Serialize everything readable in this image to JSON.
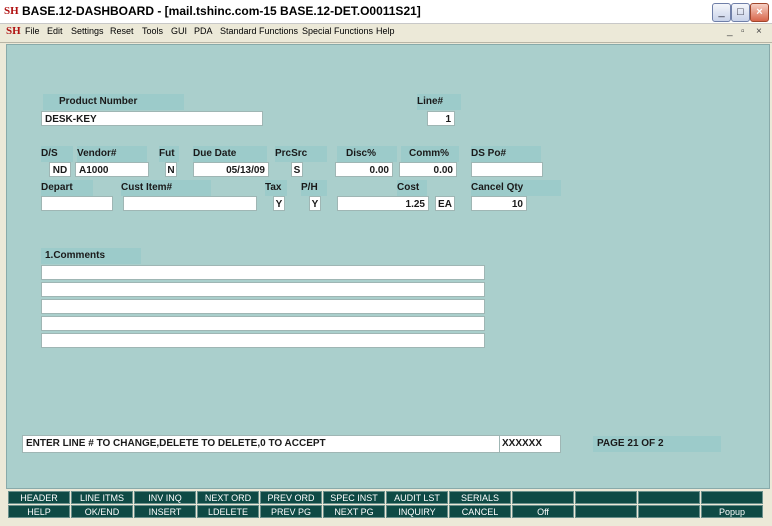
{
  "window": {
    "title": "BASE.12-DASHBOARD - [mail.tshinc.com-15 BASE.12-DET.O0011S21]",
    "minimize": "_",
    "maximize": "□",
    "close": "×",
    "doc_minimize": "_",
    "doc_restore": "▫",
    "doc_close": "×"
  },
  "menu": [
    "File",
    "Edit",
    "Settings",
    "Reset",
    "Tools",
    "GUI",
    "PDA",
    "Standard Functions",
    "Special Functions",
    "Help"
  ],
  "form": {
    "product_number_label": "Product Number",
    "product_number": "DESK-KEY",
    "line_label": "Line#",
    "line": "1",
    "ds_label": "D/S",
    "ds": "ND",
    "vendor_label": "Vendor#",
    "vendor": "A1000",
    "fut_label": "Fut",
    "fut": "N",
    "due_date_label": "Due Date",
    "due_date": "05/13/09",
    "prcsrc_label": "PrcSrc",
    "prcsrc": "S",
    "disc_label": "Disc%",
    "disc": "0.00",
    "comm_label": "Comm%",
    "comm": "0.00",
    "dspo_label": "DS Po#",
    "dspo": "",
    "depart_label": "Depart",
    "depart": "",
    "cust_item_label": "Cust Item#",
    "cust_item": "",
    "tax_label": "Tax",
    "tax": "Y",
    "ph_label": "P/H",
    "ph": "Y",
    "cost_label": "Cost",
    "cost": "1.25",
    "cost_um": "EA",
    "cancel_qty_label": "Cancel Qty",
    "cancel_qty": "10",
    "comments_label": "1.Comments",
    "comments": [
      "",
      "",
      "",
      "",
      "",
      ""
    ]
  },
  "status": {
    "prompt": "ENTER LINE # TO CHANGE,DELETE TO DELETE,0 TO ACCEPT",
    "code": "XXXXXX",
    "page": "PAGE 21 OF  2"
  },
  "function_keys": {
    "row1": [
      "HEADER",
      "LINE ITMS",
      "INV INQ",
      "NEXT ORD",
      "PREV ORD",
      "SPEC INST",
      "AUDIT LST",
      "SERIALS",
      "",
      "",
      "",
      ""
    ],
    "row2": [
      "HELP",
      "OK/END",
      "INSERT",
      "LDELETE",
      "PREV PG",
      "NEXT PG",
      "INQUIRY",
      "CANCEL",
      "Off",
      "",
      "",
      "Popup"
    ]
  }
}
